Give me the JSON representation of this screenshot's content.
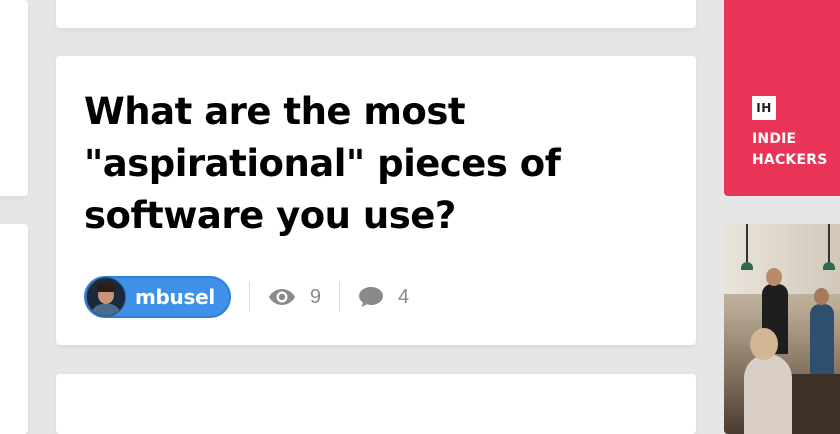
{
  "post": {
    "title": "What are the most \"aspirational\" pieces of software you use?",
    "author": "mbusel",
    "views": "9",
    "comments": "4"
  },
  "sponsor": {
    "logo_text": "IH",
    "name": "INDIE\nHACKERS",
    "color": "#ea3457"
  },
  "icons": {
    "views": "eye-icon",
    "comments": "speech-bubble-icon"
  },
  "colors": {
    "author_pill": "#3e90e8",
    "stat_text": "#8a8a8a"
  }
}
